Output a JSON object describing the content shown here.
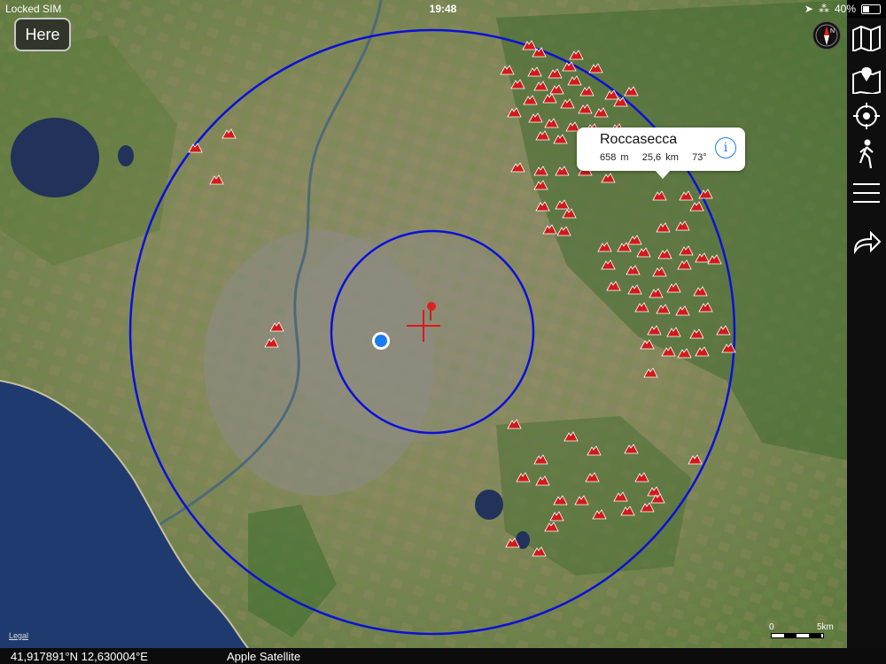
{
  "status_bar": {
    "carrier": "Locked SIM",
    "time": "19:48",
    "battery_text": "40%",
    "battery_level": 0.4
  },
  "here_button": {
    "label": "Here"
  },
  "compass": {
    "label": "N"
  },
  "sidebar": {
    "items": [
      {
        "icon": "map-icon"
      },
      {
        "icon": "pin-map-icon"
      },
      {
        "icon": "location-target-icon"
      },
      {
        "icon": "walking-person-icon"
      },
      {
        "icon": "menu-icon"
      },
      {
        "icon": "forward-arrow-icon"
      }
    ]
  },
  "callout": {
    "title": "Roccasecca",
    "elevation": "658 m",
    "distance": "25,6 km",
    "bearing": "73°",
    "info_glyph": "i"
  },
  "map": {
    "legal": "Legal",
    "scale_start": "0",
    "scale_end": "5km",
    "circle_color": "#0a10d8",
    "peak_color": "#d11a1a",
    "location_color": "#1a7cf0"
  },
  "bottom_bar": {
    "coordinates": "41,917891°N 12,630004°E",
    "map_source": "Apple Satellite"
  }
}
